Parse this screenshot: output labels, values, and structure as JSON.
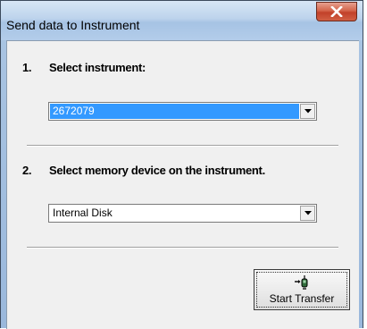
{
  "window": {
    "title": "Send data to Instrument",
    "close_icon": "close-icon"
  },
  "step1": {
    "number": "1.",
    "label": "Select instrument:",
    "selected_value": "2672079"
  },
  "step2": {
    "number": "2.",
    "label": "Select memory device on the instrument.",
    "selected_value": "Internal Disk"
  },
  "start_button": {
    "label": "Start Transfer",
    "icon": "transfer-icon"
  },
  "colors": {
    "close_button": "#c2412a",
    "selection": "#3399ff",
    "dialog_background": "#f0f0f0"
  }
}
